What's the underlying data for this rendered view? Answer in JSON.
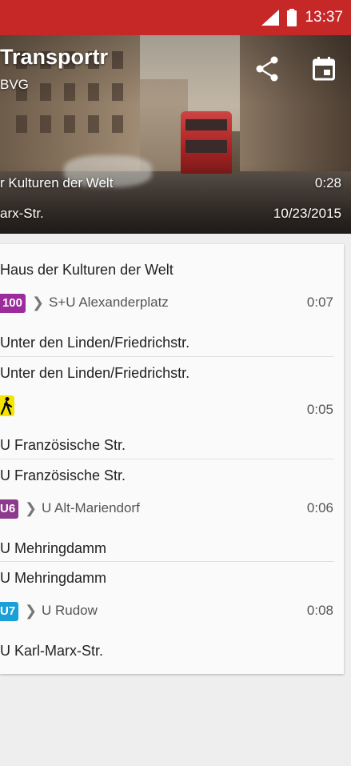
{
  "status_bar": {
    "time": "13:37",
    "bg_color": "#c62828",
    "icons": [
      "signal-icon",
      "battery-icon"
    ]
  },
  "header": {
    "title": "Transportr",
    "subtitle": "BVG",
    "from": "r Kulturen der Welt",
    "to": "arx-Str.",
    "duration": "0:28",
    "date": "10/23/2015",
    "actions": [
      "share-icon",
      "calendar-icon"
    ]
  },
  "trip": {
    "legs": [
      {
        "departure_stop": "Haus der Kulturen der Welt",
        "line": "100",
        "line_color": "#9c2c9c",
        "destination": "S+U Alexanderplatz",
        "duration": "0:07",
        "arrival_stop": "Unter den Linden/Friedrichstr."
      },
      {
        "departure_stop": "Unter den Linden/Friedrichstr.",
        "line": "walk",
        "line_color": "#f5e400",
        "destination": "",
        "duration": "0:05",
        "arrival_stop": "U Französische Str."
      },
      {
        "departure_stop": "U Französische Str.",
        "line": "U6",
        "line_color": "#8c3a8c",
        "destination": "U Alt-Mariendorf",
        "duration": "0:06",
        "arrival_stop": "U Mehringdamm"
      },
      {
        "departure_stop": "U Mehringdamm",
        "line": "U7",
        "line_color": "#1a9fd6",
        "destination": "U Rudow",
        "duration": "0:08",
        "arrival_stop": "U Karl-Marx-Str."
      }
    ]
  }
}
